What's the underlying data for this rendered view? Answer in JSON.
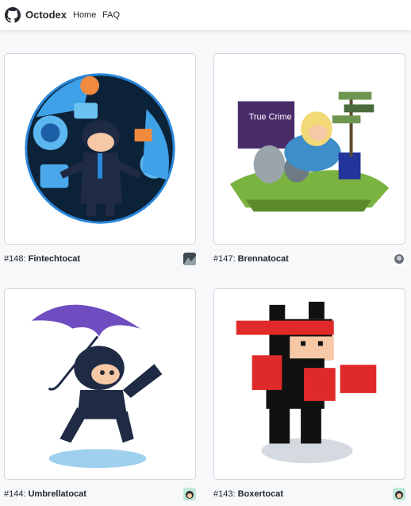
{
  "header": {
    "logo_icon": "github-mark-icon",
    "brand": "Octodex",
    "nav": [
      {
        "label": "Home"
      },
      {
        "label": "FAQ"
      }
    ]
  },
  "cards": [
    {
      "number": "#148:",
      "name": "Fintechtocat",
      "image_icon": "fintechtocat-illustration",
      "avatar_icon": "author-avatar-icon"
    },
    {
      "number": "#147:",
      "name": "Brennatocat",
      "image_icon": "brennatocat-illustration",
      "avatar_icon": "author-avatar-icon"
    },
    {
      "number": "#144:",
      "name": "Umbrellatocat",
      "image_icon": "umbrellatocat-illustration",
      "avatar_icon": "author-avatar-icon"
    },
    {
      "number": "#143:",
      "name": "Boxertocat",
      "image_icon": "boxertocat-illustration",
      "avatar_icon": "author-avatar-icon"
    }
  ],
  "card_art_texts": {
    "true_crime_sign": "True Crime"
  },
  "colors": {
    "header_bg": "#ffffff",
    "page_bg": "#f6f8fa",
    "card_border": "#d0d7de",
    "text": "#24292f"
  }
}
